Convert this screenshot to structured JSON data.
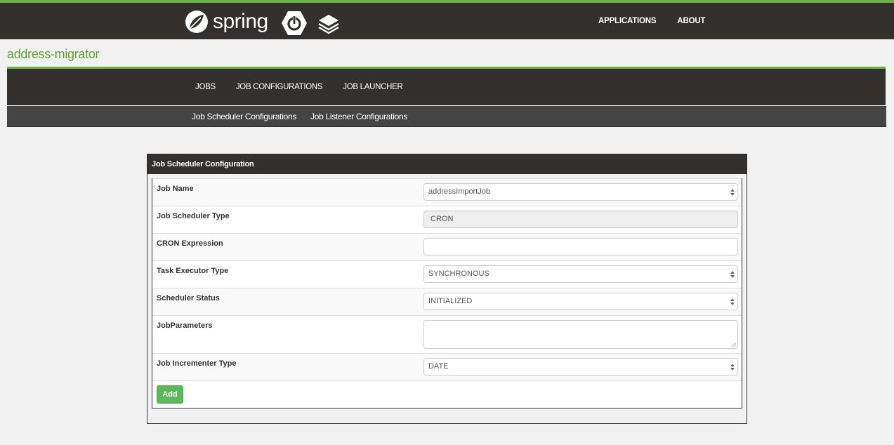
{
  "header": {
    "logo_text": "spring",
    "nav": [
      {
        "label": "APPLICATIONS"
      },
      {
        "label": "ABOUT"
      }
    ]
  },
  "app_title": "address-migrator",
  "main_nav": [
    {
      "label": "JOBS"
    },
    {
      "label": "JOB CONFIGURATIONS"
    },
    {
      "label": "JOB LAUNCHER"
    }
  ],
  "sub_nav": [
    {
      "label": "Job Scheduler Configurations"
    },
    {
      "label": "Job Listener Configurations"
    }
  ],
  "panel": {
    "title": "Job Scheduler Configuration",
    "fields": {
      "job_name": {
        "label": "Job Name",
        "value": "addressImportJob"
      },
      "scheduler_type": {
        "label": "Job Scheduler Type",
        "value": "CRON"
      },
      "cron_expression": {
        "label": "CRON Expression",
        "value": ""
      },
      "task_executor_type": {
        "label": "Task Executor Type",
        "value": "SYNCHRONOUS"
      },
      "scheduler_status": {
        "label": "Scheduler Status",
        "value": "INITIALIZED"
      },
      "job_parameters": {
        "label": "JobParameters",
        "value": ""
      },
      "incrementer_type": {
        "label": "Job Incrementer Type",
        "value": "DATE"
      }
    },
    "add_button": "Add"
  },
  "colors": {
    "brand_green": "#6db33f",
    "header_dark": "#34302d",
    "button_green": "#5cb85c"
  }
}
